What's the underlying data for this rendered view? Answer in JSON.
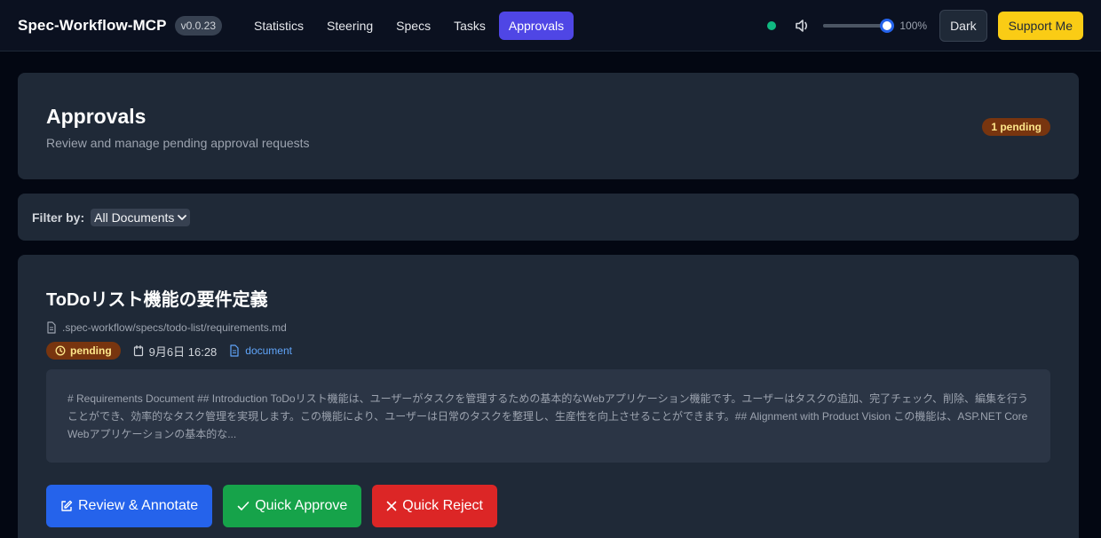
{
  "header": {
    "brand": "Spec-Workflow-MCP",
    "version": "v0.0.23",
    "nav": [
      {
        "label": "Statistics"
      },
      {
        "label": "Steering"
      },
      {
        "label": "Specs"
      },
      {
        "label": "Tasks"
      },
      {
        "label": "Approvals"
      }
    ],
    "active_nav": "Approvals",
    "volume_percent": 100,
    "volume_label": "100%",
    "theme_button": "Dark",
    "support_button": "Support Me",
    "status_color": "#10b981"
  },
  "page": {
    "title": "Approvals",
    "subtitle": "Review and manage pending approval requests",
    "pending_badge": "1 pending"
  },
  "filter": {
    "label": "Filter by:",
    "selected": "All Documents"
  },
  "approval": {
    "title": "ToDoリスト機能の要件定義",
    "path": ".spec-workflow/specs/todo-list/requirements.md",
    "status": "pending",
    "date": "9月6日 16:28",
    "type": "document",
    "preview": "# Requirements Document ## Introduction ToDoリスト機能は、ユーザーがタスクを管理するための基本的なWebアプリケーション機能です。ユーザーはタスクの追加、完了チェック、削除、編集を行うことができ、効率的なタスク管理を実現します。この機能により、ユーザーは日常のタスクを整理し、生産性を向上させることができます。## Alignment with Product Vision この機能は、ASP.NET Core Webアプリケーションの基本的な...",
    "actions": {
      "review": "Review & Annotate",
      "approve": "Quick Approve",
      "reject": "Quick Reject"
    }
  },
  "colors": {
    "accent": "#4f46e5",
    "approve": "#16a34a",
    "reject": "#dc2626",
    "review": "#2563eb",
    "pending": "#78350f"
  }
}
